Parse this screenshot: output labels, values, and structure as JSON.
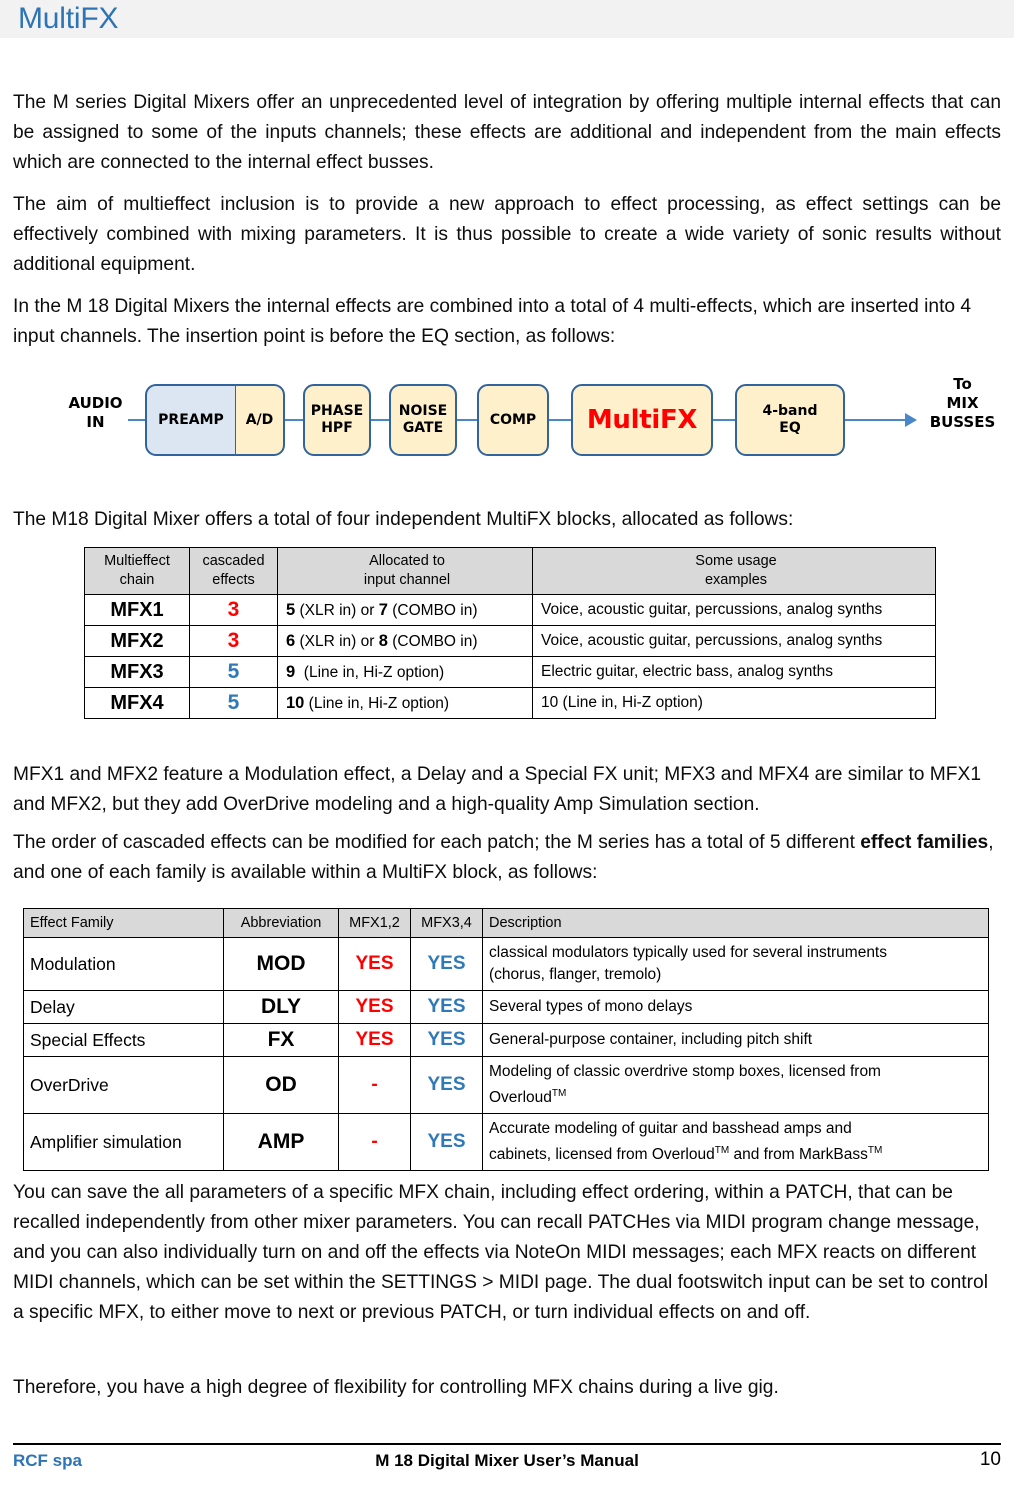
{
  "title": "MultiFX",
  "paragraphs": {
    "p1": "The M series Digital Mixers offer an unprecedented level of integration by offering multiple internal effects that can be assigned to some of the inputs channels; these effects are additional and independent from the main effects which are connected to the internal effect busses.",
    "p2": "The aim of multieffect inclusion is to provide a new approach to effect processing, as effect settings can be effectively combined with mixing parameters. It is thus possible to create a wide variety of sonic results without additional equipment.",
    "p3": "In the M 18 Digital Mixers the internal effects are combined into a total of 4 multi-effects, which are inserted into 4 input channels. The insertion point is before the EQ section, as follows:",
    "p4": "The M18 Digital Mixer offers a total of four independent MultiFX blocks, allocated as follows:",
    "p5": "MFX1 and MFX2 feature a Modulation effect, a Delay and a Special FX unit; MFX3 and MFX4 are similar to MFX1 and MFX2, but they add OverDrive modeling and a high-quality Amp Simulation section.",
    "p6_a": "The order of cascaded effects can be modified for each patch; the M series has a total of 5 different ",
    "p6_b": "effect families",
    "p6_c": ", and one of each family is available within a MultiFX block, as follows:",
    "p7": "You can save the all parameters of a specific MFX chain, including effect ordering, within a PATCH, that can be recalled independently from other mixer parameters. You can recall PATCHes via MIDI program change message, and you can also individually turn on and off the effects via NoteOn MIDI messages; each MFX reacts on different MIDI channels, which can be set within the SETTINGS > MIDI page. The dual footswitch input can be set to control a specific MFX, to either move to next or previous PATCH, or turn individual effects on and off.",
    "p8": "Therefore, you have a high degree of flexibility for controlling MFX chains during a live gig."
  },
  "diagram": {
    "input_label": "AUDIO\nIN",
    "output_label": "To\nMIX\nBUSSES",
    "blocks": [
      {
        "label": "PREAMP",
        "fill": "#dce6f2"
      },
      {
        "label": "A/D",
        "fill": "#fdf0cb"
      },
      {
        "label": "PHASE\nHPF",
        "fill": "#fdf0cb"
      },
      {
        "label": "NOISE\nGATE",
        "fill": "#fdf0cb"
      },
      {
        "label": "COMP",
        "fill": "#fdf0cb"
      },
      {
        "label": "MultiFX",
        "fill": "#fdf0cb",
        "text_color": "#ff0000"
      },
      {
        "label": "4-band\nEQ",
        "fill": "#fdf0cb"
      }
    ],
    "border_color": "#31639c",
    "connector_color": "#4a87c8"
  },
  "table_allocation": {
    "headers": [
      "Multieffect\nchain",
      "cascaded\neffects",
      "Allocated to\ninput channel",
      "Some usage\nexamples"
    ],
    "rows": [
      {
        "chain": "MFX1",
        "cascaded": "3",
        "cascaded_color": "red",
        "alloc_bold1": "5",
        "alloc_rest1": " (XLR in) or ",
        "alloc_bold2": "7",
        "alloc_rest2": " (COMBO in)",
        "usage": "Voice, acoustic guitar, percussions, analog synths"
      },
      {
        "chain": "MFX2",
        "cascaded": "3",
        "cascaded_color": "red",
        "alloc_bold1": "6",
        "alloc_rest1": " (XLR in) or ",
        "alloc_bold2": "8",
        "alloc_rest2": " (COMBO in)",
        "usage": "Voice, acoustic guitar, percussions, analog synths"
      },
      {
        "chain": "MFX3",
        "cascaded": "5",
        "cascaded_color": "blue",
        "alloc_bold1": "9",
        "alloc_rest1": "  (Line in, Hi-Z option)",
        "alloc_bold2": "",
        "alloc_rest2": "",
        "usage": "Electric guitar, electric bass, analog synths"
      },
      {
        "chain": "MFX4",
        "cascaded": "5",
        "cascaded_color": "blue",
        "alloc_bold1": "10",
        "alloc_rest1": " (Line in, Hi-Z option)",
        "alloc_bold2": "",
        "alloc_rest2": "",
        "usage": "10 (Line in, Hi-Z option)"
      }
    ]
  },
  "table_families": {
    "headers": [
      "Effect Family",
      "Abbreviation",
      "MFX1,2",
      "MFX3,4",
      "Description"
    ],
    "rows": [
      {
        "family": "Modulation",
        "abbr": "MOD",
        "mfx12": "YES",
        "mfx12_color": "red",
        "mfx34": "YES",
        "mfx34_color": "blue",
        "desc_line1": "classical modulators typically used for several instruments",
        "desc_line2": "(chorus, flanger, tremolo)",
        "desc_tm1": "",
        "desc_tm2": ""
      },
      {
        "family": "Delay",
        "abbr": "DLY",
        "mfx12": "YES",
        "mfx12_color": "red",
        "mfx34": "YES",
        "mfx34_color": "blue",
        "desc_line1": "Several types of mono delays",
        "desc_line2": "",
        "desc_tm1": "",
        "desc_tm2": ""
      },
      {
        "family": "Special Effects",
        "abbr": "FX",
        "mfx12": "YES",
        "mfx12_color": "red",
        "mfx34": "YES",
        "mfx34_color": "blue",
        "desc_line1": "General-purpose container, including pitch shift",
        "desc_line2": "",
        "desc_tm1": "",
        "desc_tm2": ""
      },
      {
        "family": "OverDrive",
        "abbr": "OD",
        "mfx12": "-",
        "mfx12_color": "red",
        "mfx34": "YES",
        "mfx34_color": "blue",
        "desc_line1": "Modeling of classic overdrive stomp boxes, licensed from",
        "desc_line2": "Overloud",
        "desc_tm1": "TM",
        "desc_tm2": ""
      },
      {
        "family": "Amplifier simulation",
        "abbr": "AMP",
        "mfx12": "-",
        "mfx12_color": "red",
        "mfx34": "YES",
        "mfx34_color": "blue",
        "desc_line1": "Accurate modeling of guitar and basshead amps and",
        "desc_line2": "cabinets, licensed from Overloud",
        "desc_tm1": "TM",
        "desc_tm2": " and from MarkBass",
        "desc_tm3": "TM"
      }
    ]
  },
  "footer": {
    "left": "RCF spa",
    "center": "M 18 Digital Mixer User’s Manual",
    "page": "10"
  }
}
